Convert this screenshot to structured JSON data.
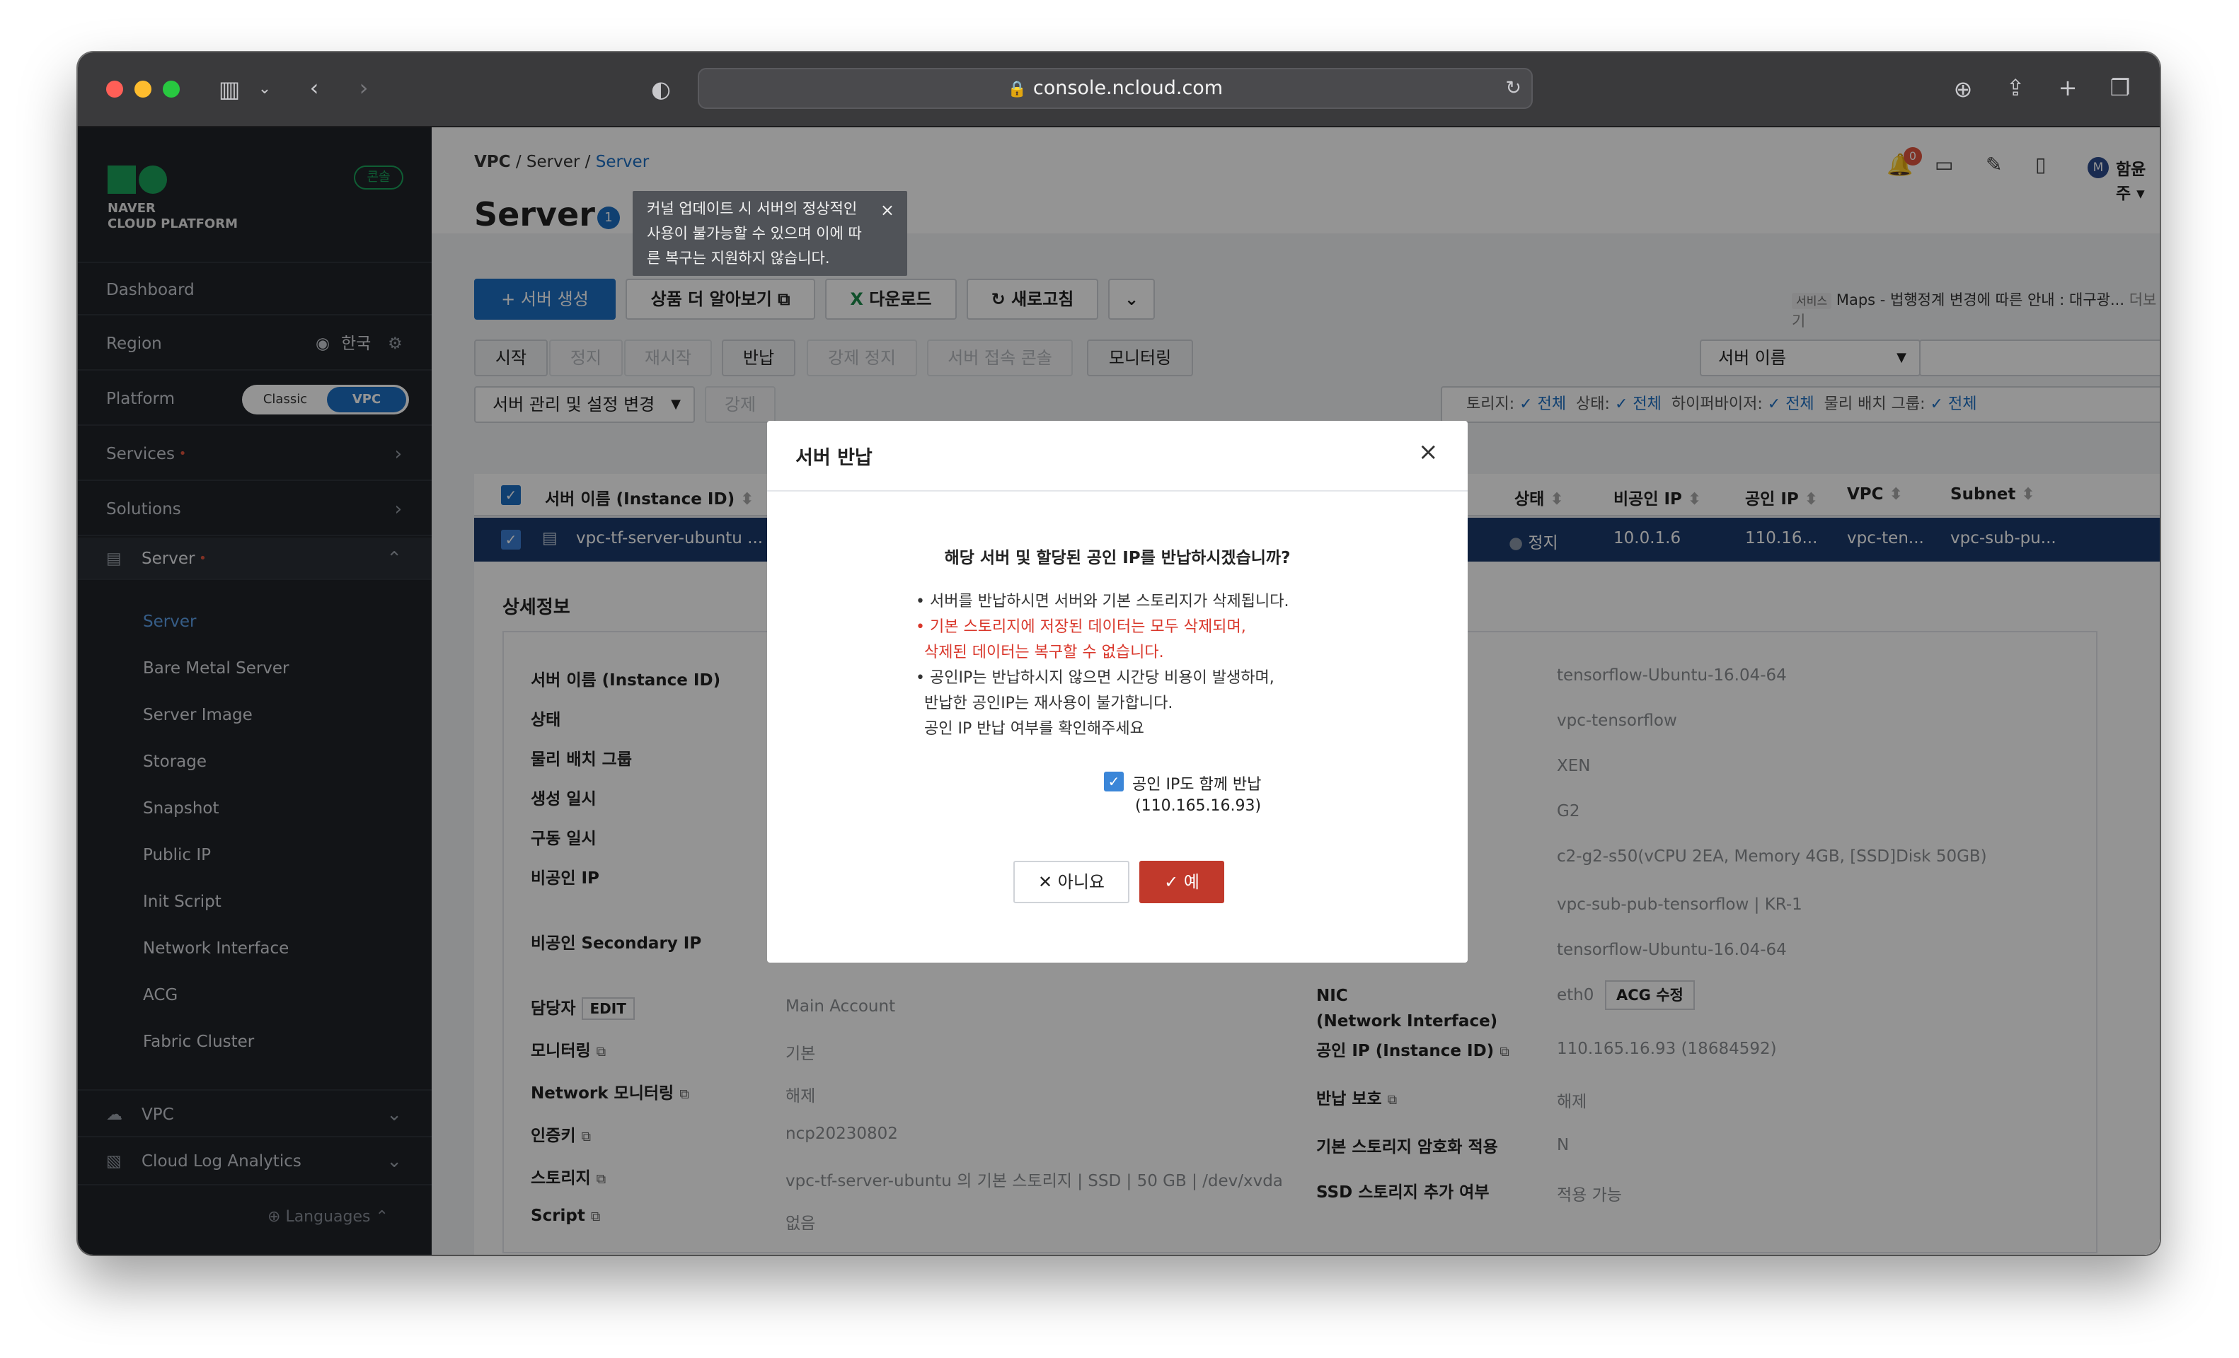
{
  "browser": {
    "url": "console.ncloud.com"
  },
  "sidebar": {
    "logo_line1": "NAVER",
    "logo_line2": "CLOUD PLATFORM",
    "console_badge": "콘솔",
    "dashboard": "Dashboard",
    "region_label": "Region",
    "region_value": "한국",
    "platform_label": "Platform",
    "platform_classic": "Classic",
    "platform_vpc": "VPC",
    "services": "Services",
    "solutions": "Solutions",
    "server": "Server",
    "server_items": [
      "Server",
      "Bare Metal Server",
      "Server Image",
      "Storage",
      "Snapshot",
      "Public IP",
      "Init Script",
      "Network Interface",
      "ACG",
      "Fabric Cluster"
    ],
    "vpc": "VPC",
    "cloud_log": "Cloud Log Analytics",
    "languages": "Languages"
  },
  "header": {
    "breadcrumb": [
      "VPC",
      "Server",
      "Server"
    ],
    "title": "Server",
    "info_badge": "1",
    "tooltip": "커널 업데이트 시 서버의 정상적인 사용이 불가능할 수 있으며 이에 따른 복구는 지원하지 않습니다.",
    "notif_count": "0",
    "user_initial": "M",
    "user_name": "함윤주"
  },
  "actions": {
    "create": "+ 서버 생성",
    "learn_more": "상품 더 알아보기",
    "download": "다운로드",
    "refresh": "새로고침"
  },
  "notice": {
    "tag": "서비스",
    "text": "Maps - 법행정계 변경에 따른 안내 : 대구광...",
    "more": "더보기"
  },
  "ops": {
    "start": "시작",
    "stop": "정지",
    "restart": "재시작",
    "return": "반납",
    "force_stop": "강제 정지",
    "console": "서버 접속 콘솔",
    "monitoring": "모니터링",
    "manage": "서버 관리 및 설정 변경",
    "force": "강제"
  },
  "search": {
    "select": "서버 이름"
  },
  "filters": {
    "storage": "토리지:",
    "storage_v": "전체",
    "state": "상태:",
    "state_v": "전체",
    "hypervisor": "하이퍼바이저:",
    "hypervisor_v": "전체",
    "placement": "물리 배치 그룹:",
    "placement_v": "전체"
  },
  "table": {
    "columns": [
      "서버 이름 (Instance ID)",
      "상태",
      "비공인 IP",
      "공인 IP",
      "VPC",
      "Subnet"
    ],
    "row": {
      "name": "vpc-tf-server-ubuntu ...",
      "state": "정지",
      "private_ip": "10.0.1.6",
      "public_ip": "110.16...",
      "vpc": "vpc-ten...",
      "subnet": "vpc-sub-pu..."
    }
  },
  "detail": {
    "title": "상세정보",
    "left_labels": [
      "서버 이름 (Instance ID)",
      "상태",
      "물리 배치 그룹",
      "생성 일시",
      "구동 일시",
      "비공인 IP",
      "비공인 Secondary IP",
      "담당자",
      "모니터링",
      "Network 모니터링",
      "인증키",
      "스토리지",
      "Script"
    ],
    "edit": "EDIT",
    "left_values": {
      "manager": "Main Account",
      "monitoring": "기본",
      "network_monitoring": "해제",
      "auth_key": "ncp20230802",
      "storage": "vpc-tf-server-ubuntu 의 기본 스토리지 | SSD | 50 GB | /dev/xvda",
      "script": "없음"
    },
    "right_values": [
      "tensorflow-Ubuntu-16.04-64",
      "vpc-tensorflow",
      "XEN",
      "G2",
      "c2-g2-s50(vCPU 2EA, Memory 4GB, [SSD]Disk 50GB)",
      "vpc-sub-pub-tensorflow | KR-1",
      "tensorflow-Ubuntu-16.04-64"
    ],
    "nic_label": "NIC",
    "nic_label2": "(Network Interface)",
    "nic_value": "eth0",
    "acg_edit": "ACG 수정",
    "public_ip_label": "공인 IP (Instance ID)",
    "public_ip_value": "110.165.16.93 (18684592)",
    "return_protect_label": "반납 보호",
    "return_protect_value": "해제",
    "encrypt_label": "기본 스토리지 암호화 적용",
    "encrypt_value": "N",
    "ssd_label": "SSD 스토리지 추가 여부",
    "ssd_value": "적용 가능"
  },
  "modal": {
    "title": "서버 반납",
    "question": "해당 서버 및 할당된 공인 IP를 반납하시겠습니까?",
    "b1": "서버를 반납하시면 서버와 기본 스토리지가 삭제됩니다.",
    "b2a": "기본 스토리지에 저장된 데이터는 모두 삭제되며,",
    "b2b": "삭제된 데이터는 복구할 수 없습니다.",
    "b3a": "공인IP는 반납하시지 않으면 시간당 비용이 발생하며,",
    "b3b": "반납한 공인IP는 재사용이 불가합니다.",
    "b3c": "공인 IP 반납 여부를 확인해주세요",
    "checkbox": "공인 IP도 함께 반납",
    "ip": "(110.165.16.93)",
    "no": "아니요",
    "yes": "예"
  },
  "colors": {
    "accent": "#1c6fc3",
    "danger": "#c1392b",
    "sidebar": "#1f2329"
  }
}
